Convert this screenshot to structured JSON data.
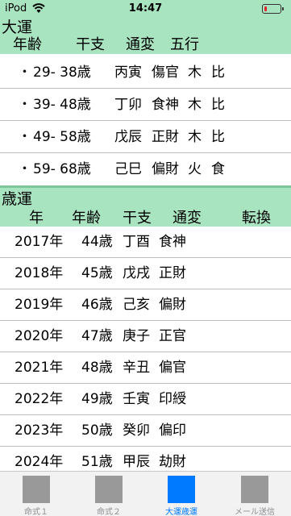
{
  "status_bar": {
    "carrier": "iPod",
    "time": "14:47",
    "battery_color": "#e0262c"
  },
  "daiun": {
    "title": "大運",
    "columns": [
      "年齢",
      "干支",
      "通変",
      "五行"
    ],
    "rows": [
      {
        "dot": "・",
        "age": "29- 38歳",
        "kanshi": "丙寅",
        "tsuhen": "傷官",
        "gogyo1": "木",
        "gogyo2": "比"
      },
      {
        "dot": "・",
        "age": "39- 48歳",
        "kanshi": "丁卯",
        "tsuhen": "食神",
        "gogyo1": "木",
        "gogyo2": "比"
      },
      {
        "dot": "・",
        "age": "49- 58歳",
        "kanshi": "戊辰",
        "tsuhen": "正財",
        "gogyo1": "木",
        "gogyo2": "比"
      },
      {
        "dot": "・",
        "age": "59- 68歳",
        "kanshi": "己巳",
        "tsuhen": "偏財",
        "gogyo1": "火",
        "gogyo2": "食"
      }
    ]
  },
  "saiun": {
    "title": "歳運",
    "columns": [
      "年",
      "年齢",
      "干支",
      "通変",
      "転換"
    ],
    "rows": [
      {
        "year": "2017年",
        "age": "44歳",
        "kanshi": "丁酉",
        "tsuhen": "食神"
      },
      {
        "year": "2018年",
        "age": "45歳",
        "kanshi": "戊戌",
        "tsuhen": "正財"
      },
      {
        "year": "2019年",
        "age": "46歳",
        "kanshi": "己亥",
        "tsuhen": "偏財"
      },
      {
        "year": "2020年",
        "age": "47歳",
        "kanshi": "庚子",
        "tsuhen": "正官"
      },
      {
        "year": "2021年",
        "age": "48歳",
        "kanshi": "辛丑",
        "tsuhen": "偏官"
      },
      {
        "year": "2022年",
        "age": "49歳",
        "kanshi": "壬寅",
        "tsuhen": "印綬"
      },
      {
        "year": "2023年",
        "age": "50歳",
        "kanshi": "癸卯",
        "tsuhen": "偏印"
      },
      {
        "year": "2024年",
        "age": "51歳",
        "kanshi": "甲辰",
        "tsuhen": "劫財"
      }
    ]
  },
  "tab_bar": {
    "tabs": [
      {
        "label": "命式１",
        "active": false
      },
      {
        "label": "命式２",
        "active": false
      },
      {
        "label": "大運歳運",
        "active": true
      },
      {
        "label": "メール送信",
        "active": false
      }
    ],
    "active_color": "#007aff",
    "inactive_color": "#999999"
  }
}
